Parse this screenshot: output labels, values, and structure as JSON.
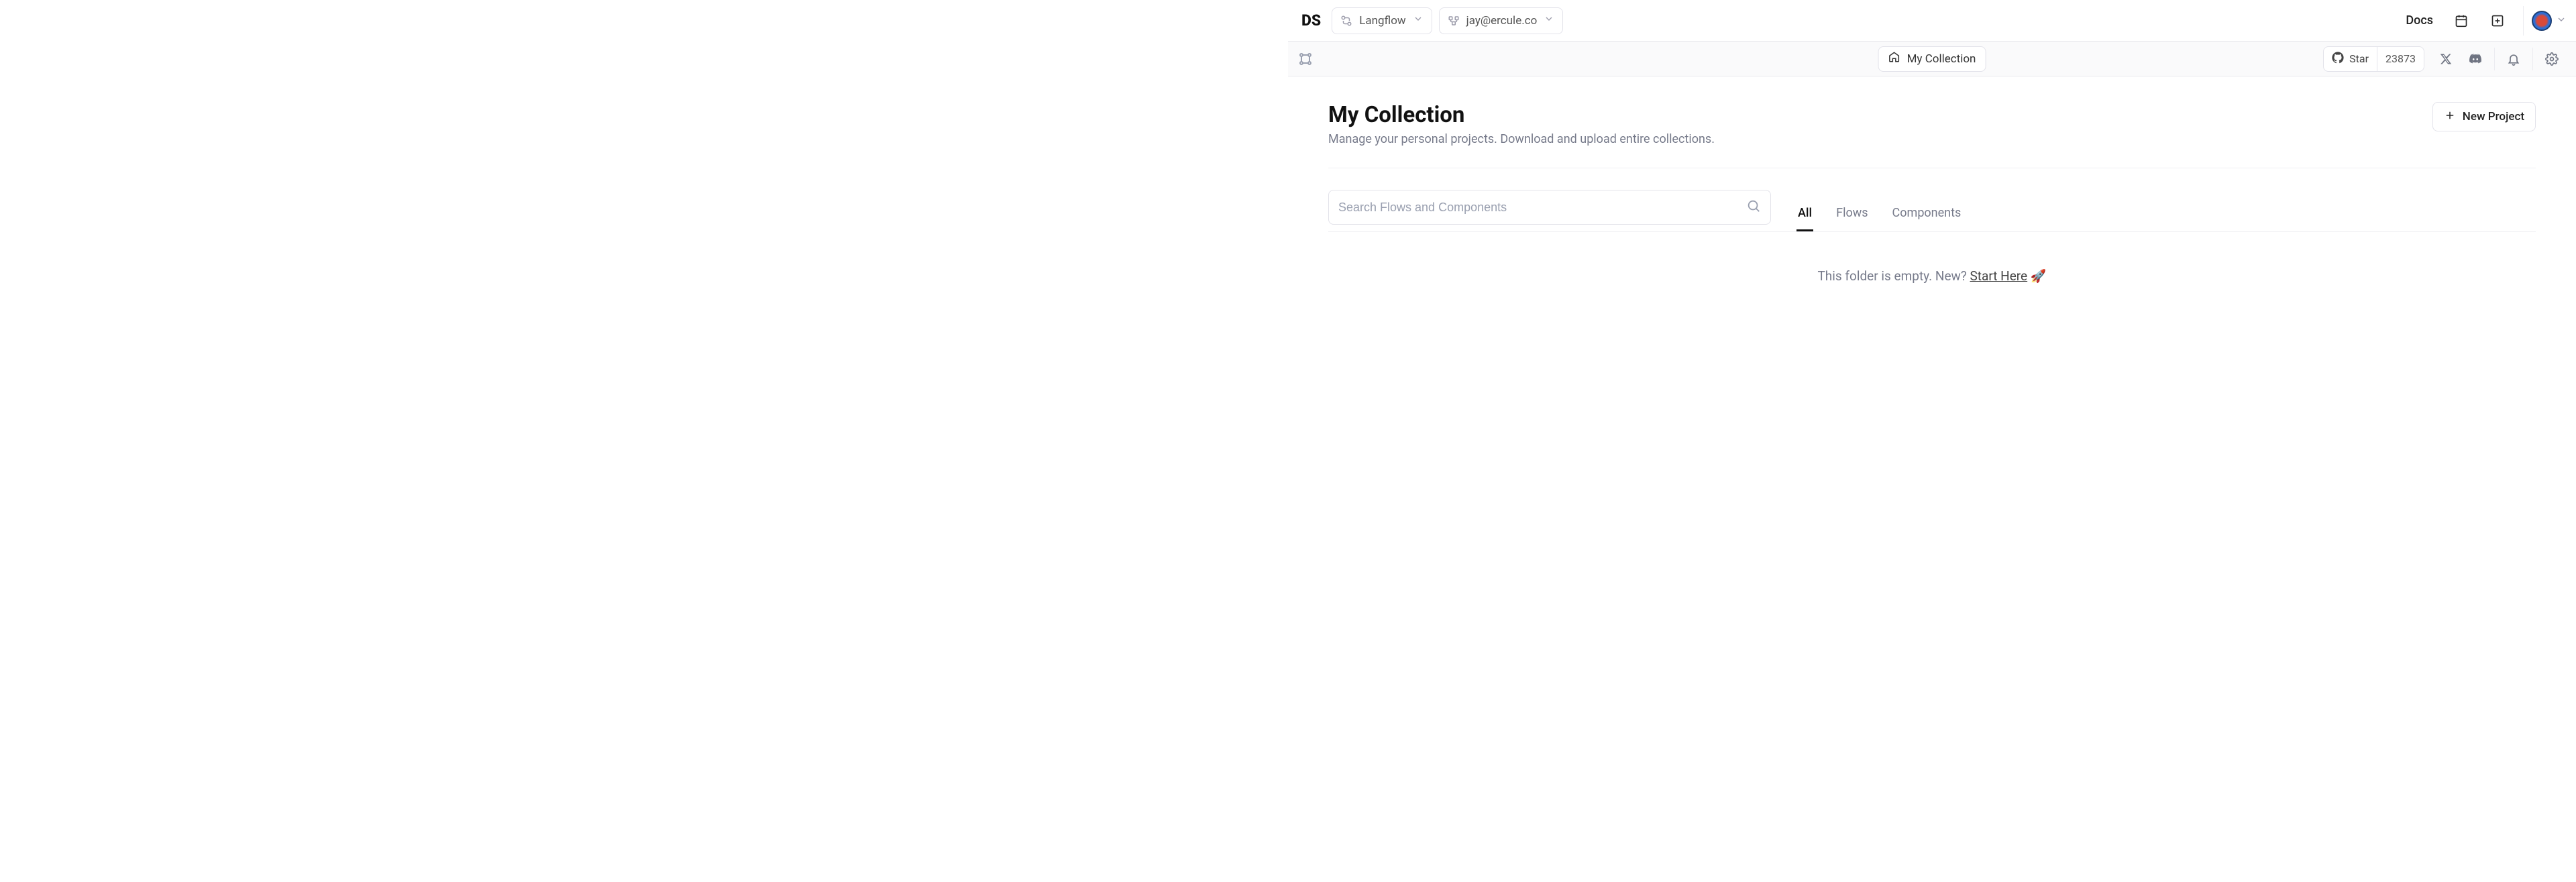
{
  "header": {
    "logo": "DS",
    "workspace_label": "Langflow",
    "account_label": "jay@ercule.co",
    "docs_label": "Docs"
  },
  "subheader": {
    "collection_label": "My Collection",
    "star_label": "Star",
    "star_count": "23873"
  },
  "page": {
    "title": "My Collection",
    "subtitle": "Manage your personal projects. Download and upload entire collections.",
    "new_project_label": "New Project"
  },
  "search": {
    "placeholder": "Search Flows and Components"
  },
  "tabs": {
    "all": "All",
    "flows": "Flows",
    "components": "Components"
  },
  "empty": {
    "prefix": "This folder is empty. New? ",
    "link": "Start Here",
    "emoji": "🚀"
  }
}
